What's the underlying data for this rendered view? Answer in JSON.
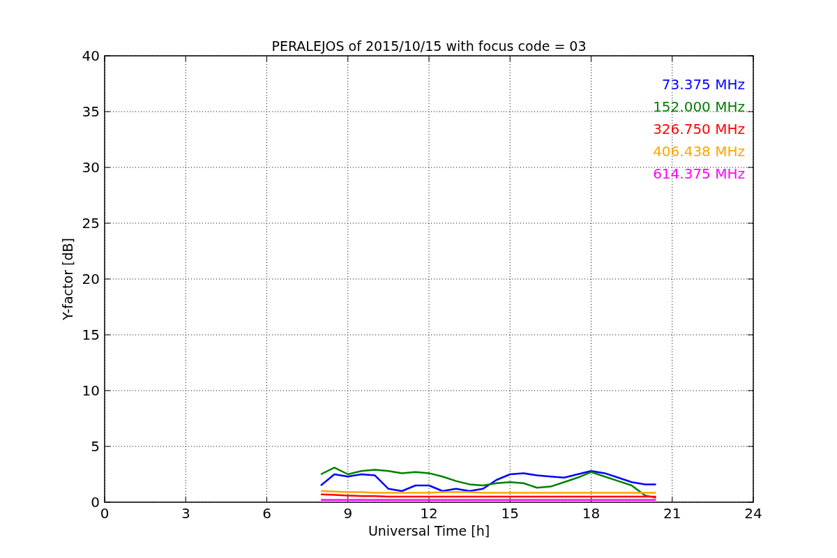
{
  "figure": {
    "chart_data": {
      "type": "line",
      "title": "PERALEJOS of 2015/10/15 with focus code = 03",
      "xlabel": "Universal Time [h]",
      "ylabel": "Y-factor [dB]",
      "x": [
        8,
        8.5,
        9,
        9.5,
        10,
        10.5,
        11,
        11.5,
        12,
        12.5,
        13,
        13.5,
        14,
        14.5,
        15,
        15.5,
        16,
        16.5,
        17,
        17.5,
        18,
        18.5,
        19,
        19.5,
        20,
        20.4
      ],
      "series": [
        {
          "name": "73.375 MHz",
          "color": "#0000ff",
          "values": [
            1.5,
            2.5,
            2.3,
            2.5,
            2.4,
            1.2,
            1.0,
            1.5,
            1.5,
            1.0,
            1.2,
            1.0,
            1.2,
            2.0,
            2.5,
            2.6,
            2.4,
            2.3,
            2.2,
            2.5,
            2.8,
            2.6,
            2.2,
            1.8,
            1.6,
            1.6
          ]
        },
        {
          "name": "152.000 MHz",
          "color": "#008000",
          "values": [
            2.5,
            3.1,
            2.5,
            2.8,
            2.9,
            2.8,
            2.6,
            2.7,
            2.6,
            2.3,
            1.9,
            1.6,
            1.5,
            1.7,
            1.8,
            1.7,
            1.3,
            1.4,
            1.8,
            2.2,
            2.7,
            2.3,
            1.9,
            1.5,
            0.6,
            0.4
          ]
        },
        {
          "name": "326.750 MHz",
          "color": "#ff0000",
          "values": [
            0.7,
            0.65,
            0.6,
            0.55,
            0.55,
            0.5,
            0.5,
            0.5,
            0.5,
            0.5,
            0.5,
            0.5,
            0.5,
            0.5,
            0.5,
            0.5,
            0.5,
            0.5,
            0.5,
            0.5,
            0.5,
            0.5,
            0.5,
            0.5,
            0.5,
            0.5
          ]
        },
        {
          "name": "406.438 MHz",
          "color": "#ffa500",
          "values": [
            1.0,
            0.95,
            0.9,
            0.9,
            0.85,
            0.85,
            0.85,
            0.85,
            0.85,
            0.9,
            0.9,
            0.9,
            0.85,
            0.85,
            0.85,
            0.85,
            0.85,
            0.85,
            0.85,
            0.85,
            0.85,
            0.85,
            0.85,
            0.85,
            0.85,
            0.85
          ]
        },
        {
          "name": "614.375 MHz",
          "color": "#ff00ff",
          "values": [
            0.2,
            0.2,
            0.2,
            0.2,
            0.2,
            0.2,
            0.2,
            0.2,
            0.2,
            0.2,
            0.2,
            0.2,
            0.2,
            0.2,
            0.2,
            0.2,
            0.2,
            0.2,
            0.2,
            0.2,
            0.2,
            0.2,
            0.2,
            0.2,
            0.2,
            0.2
          ]
        }
      ],
      "grid": true,
      "xlim": [
        0,
        24
      ],
      "ylim": [
        0,
        40
      ],
      "xticks": [
        0,
        3,
        6,
        9,
        12,
        15,
        18,
        21,
        24
      ],
      "yticks": [
        0,
        5,
        10,
        15,
        20,
        25,
        30,
        35,
        40
      ]
    }
  }
}
